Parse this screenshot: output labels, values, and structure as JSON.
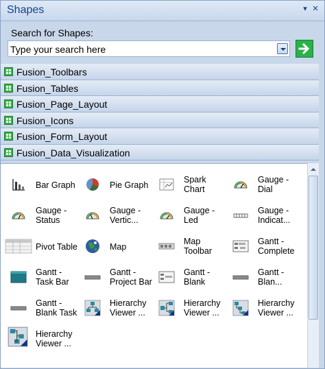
{
  "panel": {
    "title": "Shapes"
  },
  "search": {
    "label": "Search for Shapes:",
    "placeholder": "Type your search here"
  },
  "stencils": [
    {
      "label": "Fusion_Toolbars"
    },
    {
      "label": "Fusion_Tables"
    },
    {
      "label": "Fusion_Page_Layout"
    },
    {
      "label": "Fusion_Icons"
    },
    {
      "label": "Fusion_Form_Layout"
    },
    {
      "label": "Fusion_Data_Visualization"
    }
  ],
  "shapes": [
    {
      "label": "Bar Graph",
      "icon": "bar-graph-icon"
    },
    {
      "label": "Pie Graph",
      "icon": "pie-graph-icon"
    },
    {
      "label": "Spark Chart",
      "icon": "spark-chart-icon"
    },
    {
      "label": "Gauge - Dial",
      "icon": "gauge-dial-icon"
    },
    {
      "label": "Gauge - Status",
      "icon": "gauge-status-icon"
    },
    {
      "label": "Gauge - Vertic...",
      "icon": "gauge-vertical-icon"
    },
    {
      "label": "Gauge - Led",
      "icon": "gauge-led-icon"
    },
    {
      "label": "Gauge - Indicat...",
      "icon": "gauge-indicator-icon"
    },
    {
      "label": "Pivot Table",
      "icon": "pivot-table-icon"
    },
    {
      "label": "Map",
      "icon": "map-icon"
    },
    {
      "label": "Map Toolbar",
      "icon": "map-toolbar-icon"
    },
    {
      "label": "Gantt - Complete",
      "icon": "gantt-complete-icon"
    },
    {
      "label": "Gantt - Task Bar",
      "icon": "gantt-task-bar-icon"
    },
    {
      "label": "Gantt - Project Bar",
      "icon": "gantt-project-bar-icon"
    },
    {
      "label": "Gantt - Blank",
      "icon": "gantt-blank-icon"
    },
    {
      "label": "Gantt - Blan...",
      "icon": "gantt-blank-2-icon"
    },
    {
      "label": "Gantt - Blank Task",
      "icon": "gantt-blank-task-icon"
    },
    {
      "label": "Hierarchy Viewer ...",
      "icon": "hierarchy-viewer-icon"
    },
    {
      "label": "Hierarchy Viewer ...",
      "icon": "hierarchy-viewer-icon"
    },
    {
      "label": "Hierarchy Viewer ...",
      "icon": "hierarchy-viewer-icon"
    },
    {
      "label": "Hierarchy Viewer ...",
      "icon": "hierarchy-viewer-icon"
    }
  ],
  "colors": {
    "header_blue": "#15428b",
    "go_green": "#2bb14b",
    "stencil_green": "#37b34a"
  }
}
